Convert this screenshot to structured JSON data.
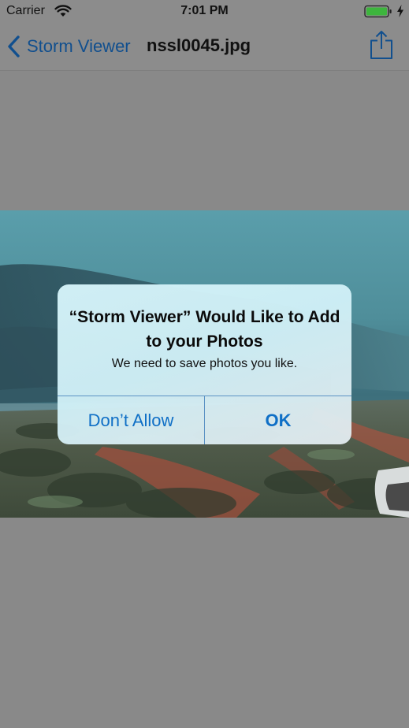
{
  "status_bar": {
    "carrier": "Carrier",
    "time": "7:01 PM",
    "icons": [
      "wifi-icon",
      "battery-icon",
      "charging-bolt-icon"
    ],
    "battery_color": "#3db53d"
  },
  "nav_bar": {
    "back_label": "Storm Viewer",
    "title": "nssl0045.jpg",
    "icons": [
      "chevron-left-icon",
      "share-icon"
    ],
    "accent_color": "#114f8e"
  },
  "photo": {
    "subject": "storm-landscape"
  },
  "alert": {
    "title": "“Storm Viewer” Would Like to Add to your Photos",
    "message": "We need to save photos you like.",
    "cancel_label": "Don’t Allow",
    "ok_label": "OK",
    "button_color": "#0f6fc6"
  }
}
